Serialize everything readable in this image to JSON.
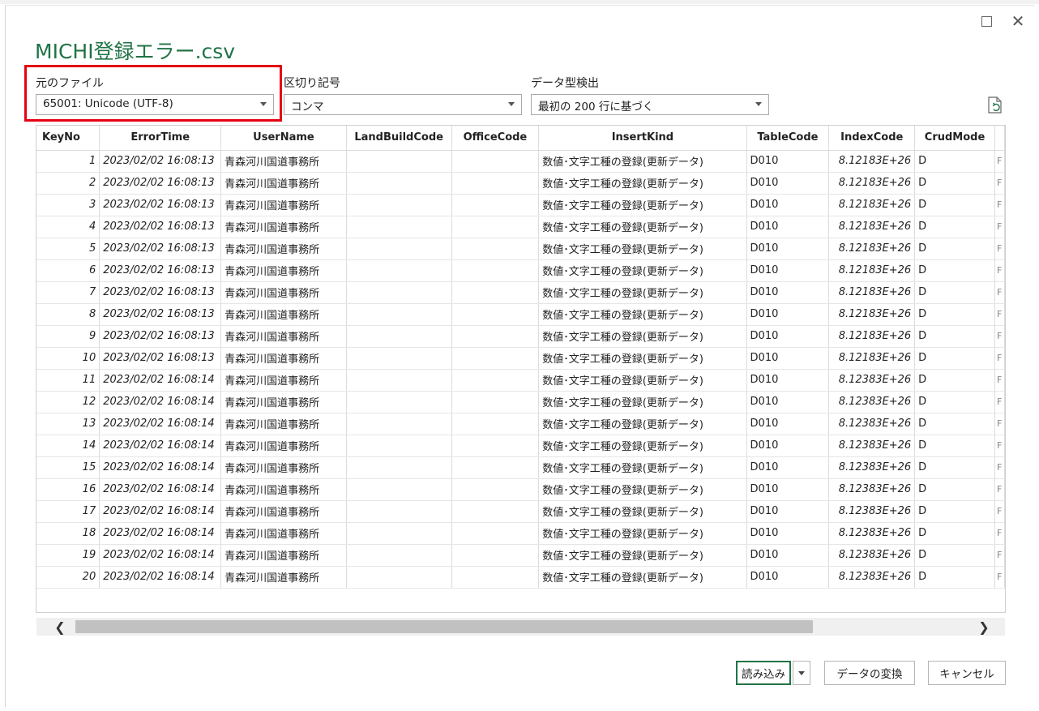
{
  "window": {
    "title": "MICHI登録エラー.csv",
    "maximize_icon": "maximize-icon",
    "close_icon": "close-icon",
    "close_glyph": "✕"
  },
  "options": {
    "file_origin": {
      "label": "元のファイル",
      "value": "65001: Unicode (UTF-8)"
    },
    "delimiter": {
      "label": "区切り記号",
      "value": "コンマ"
    },
    "type_detection": {
      "label": "データ型検出",
      "value": "最初の 200 行に基づく"
    },
    "refresh_icon": "document-refresh-icon"
  },
  "highlight_color": "#e50012",
  "accent_color": "#217346",
  "table": {
    "columns": [
      "KeyNo",
      "ErrorTime",
      "UserName",
      "LandBuildCode",
      "OfficeCode",
      "InsertKind",
      "TableCode",
      "IndexCode",
      "CrudMode"
    ],
    "clipped_glyph": "F",
    "rows": [
      [
        "1",
        "2023/02/02 16:08:13",
        "青森河川国道事務所",
        "",
        "",
        "数値･文字工種の登録(更新データ)",
        "D010",
        "8.12183E+26",
        "D"
      ],
      [
        "2",
        "2023/02/02 16:08:13",
        "青森河川国道事務所",
        "",
        "",
        "数値･文字工種の登録(更新データ)",
        "D010",
        "8.12183E+26",
        "D"
      ],
      [
        "3",
        "2023/02/02 16:08:13",
        "青森河川国道事務所",
        "",
        "",
        "数値･文字工種の登録(更新データ)",
        "D010",
        "8.12183E+26",
        "D"
      ],
      [
        "4",
        "2023/02/02 16:08:13",
        "青森河川国道事務所",
        "",
        "",
        "数値･文字工種の登録(更新データ)",
        "D010",
        "8.12183E+26",
        "D"
      ],
      [
        "5",
        "2023/02/02 16:08:13",
        "青森河川国道事務所",
        "",
        "",
        "数値･文字工種の登録(更新データ)",
        "D010",
        "8.12183E+26",
        "D"
      ],
      [
        "6",
        "2023/02/02 16:08:13",
        "青森河川国道事務所",
        "",
        "",
        "数値･文字工種の登録(更新データ)",
        "D010",
        "8.12183E+26",
        "D"
      ],
      [
        "7",
        "2023/02/02 16:08:13",
        "青森河川国道事務所",
        "",
        "",
        "数値･文字工種の登録(更新データ)",
        "D010",
        "8.12183E+26",
        "D"
      ],
      [
        "8",
        "2023/02/02 16:08:13",
        "青森河川国道事務所",
        "",
        "",
        "数値･文字工種の登録(更新データ)",
        "D010",
        "8.12183E+26",
        "D"
      ],
      [
        "9",
        "2023/02/02 16:08:13",
        "青森河川国道事務所",
        "",
        "",
        "数値･文字工種の登録(更新データ)",
        "D010",
        "8.12183E+26",
        "D"
      ],
      [
        "10",
        "2023/02/02 16:08:13",
        "青森河川国道事務所",
        "",
        "",
        "数値･文字工種の登録(更新データ)",
        "D010",
        "8.12183E+26",
        "D"
      ],
      [
        "11",
        "2023/02/02 16:08:14",
        "青森河川国道事務所",
        "",
        "",
        "数値･文字工種の登録(更新データ)",
        "D010",
        "8.12383E+26",
        "D"
      ],
      [
        "12",
        "2023/02/02 16:08:14",
        "青森河川国道事務所",
        "",
        "",
        "数値･文字工種の登録(更新データ)",
        "D010",
        "8.12383E+26",
        "D"
      ],
      [
        "13",
        "2023/02/02 16:08:14",
        "青森河川国道事務所",
        "",
        "",
        "数値･文字工種の登録(更新データ)",
        "D010",
        "8.12383E+26",
        "D"
      ],
      [
        "14",
        "2023/02/02 16:08:14",
        "青森河川国道事務所",
        "",
        "",
        "数値･文字工種の登録(更新データ)",
        "D010",
        "8.12383E+26",
        "D"
      ],
      [
        "15",
        "2023/02/02 16:08:14",
        "青森河川国道事務所",
        "",
        "",
        "数値･文字工種の登録(更新データ)",
        "D010",
        "8.12383E+26",
        "D"
      ],
      [
        "16",
        "2023/02/02 16:08:14",
        "青森河川国道事務所",
        "",
        "",
        "数値･文字工種の登録(更新データ)",
        "D010",
        "8.12383E+26",
        "D"
      ],
      [
        "17",
        "2023/02/02 16:08:14",
        "青森河川国道事務所",
        "",
        "",
        "数値･文字工種の登録(更新データ)",
        "D010",
        "8.12383E+26",
        "D"
      ],
      [
        "18",
        "2023/02/02 16:08:14",
        "青森河川国道事務所",
        "",
        "",
        "数値･文字工種の登録(更新データ)",
        "D010",
        "8.12383E+26",
        "D"
      ],
      [
        "19",
        "2023/02/02 16:08:14",
        "青森河川国道事務所",
        "",
        "",
        "数値･文字工種の登録(更新データ)",
        "D010",
        "8.12383E+26",
        "D"
      ],
      [
        "20",
        "2023/02/02 16:08:14",
        "青森河川国道事務所",
        "",
        "",
        "数値･文字工種の登録(更新データ)",
        "D010",
        "8.12383E+26",
        "D"
      ]
    ]
  },
  "scrollbar": {
    "left_glyph": "❮",
    "right_glyph": "❯"
  },
  "buttons": {
    "load": "読み込み",
    "transform": "データの変換",
    "cancel": "キャンセル"
  }
}
